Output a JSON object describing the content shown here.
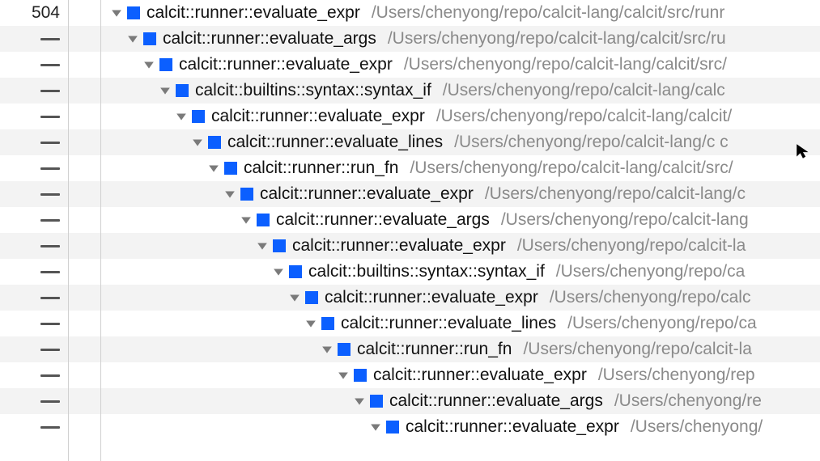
{
  "first_count": "504",
  "rows": [
    {
      "indent": 0,
      "fn": "calcit::runner::evaluate_expr",
      "path": "/Users/chenyong/repo/calcit-lang/calcit/src/runr"
    },
    {
      "indent": 1,
      "fn": "calcit::runner::evaluate_args",
      "path": "/Users/chenyong/repo/calcit-lang/calcit/src/ru"
    },
    {
      "indent": 2,
      "fn": "calcit::runner::evaluate_expr",
      "path": "/Users/chenyong/repo/calcit-lang/calcit/src/"
    },
    {
      "indent": 3,
      "fn": "calcit::builtins::syntax::syntax_if",
      "path": "/Users/chenyong/repo/calcit-lang/calc"
    },
    {
      "indent": 4,
      "fn": "calcit::runner::evaluate_expr",
      "path": "/Users/chenyong/repo/calcit-lang/calcit/"
    },
    {
      "indent": 5,
      "fn": "calcit::runner::evaluate_lines",
      "path": "/Users/chenyong/repo/calcit-lang/c  c"
    },
    {
      "indent": 6,
      "fn": "calcit::runner::run_fn",
      "path": "/Users/chenyong/repo/calcit-lang/calcit/src/"
    },
    {
      "indent": 7,
      "fn": "calcit::runner::evaluate_expr",
      "path": "/Users/chenyong/repo/calcit-lang/c"
    },
    {
      "indent": 8,
      "fn": "calcit::runner::evaluate_args",
      "path": "/Users/chenyong/repo/calcit-lang"
    },
    {
      "indent": 9,
      "fn": "calcit::runner::evaluate_expr",
      "path": "/Users/chenyong/repo/calcit-la"
    },
    {
      "indent": 10,
      "fn": "calcit::builtins::syntax::syntax_if",
      "path": "/Users/chenyong/repo/ca"
    },
    {
      "indent": 11,
      "fn": "calcit::runner::evaluate_expr",
      "path": "/Users/chenyong/repo/calc"
    },
    {
      "indent": 12,
      "fn": "calcit::runner::evaluate_lines",
      "path": "/Users/chenyong/repo/ca"
    },
    {
      "indent": 13,
      "fn": "calcit::runner::run_fn",
      "path": "/Users/chenyong/repo/calcit-la"
    },
    {
      "indent": 14,
      "fn": "calcit::runner::evaluate_expr",
      "path": "/Users/chenyong/rep"
    },
    {
      "indent": 15,
      "fn": "calcit::runner::evaluate_args",
      "path": "/Users/chenyong/re"
    },
    {
      "indent": 16,
      "fn": "calcit::runner::evaluate_expr",
      "path": "/Users/chenyong/"
    }
  ]
}
